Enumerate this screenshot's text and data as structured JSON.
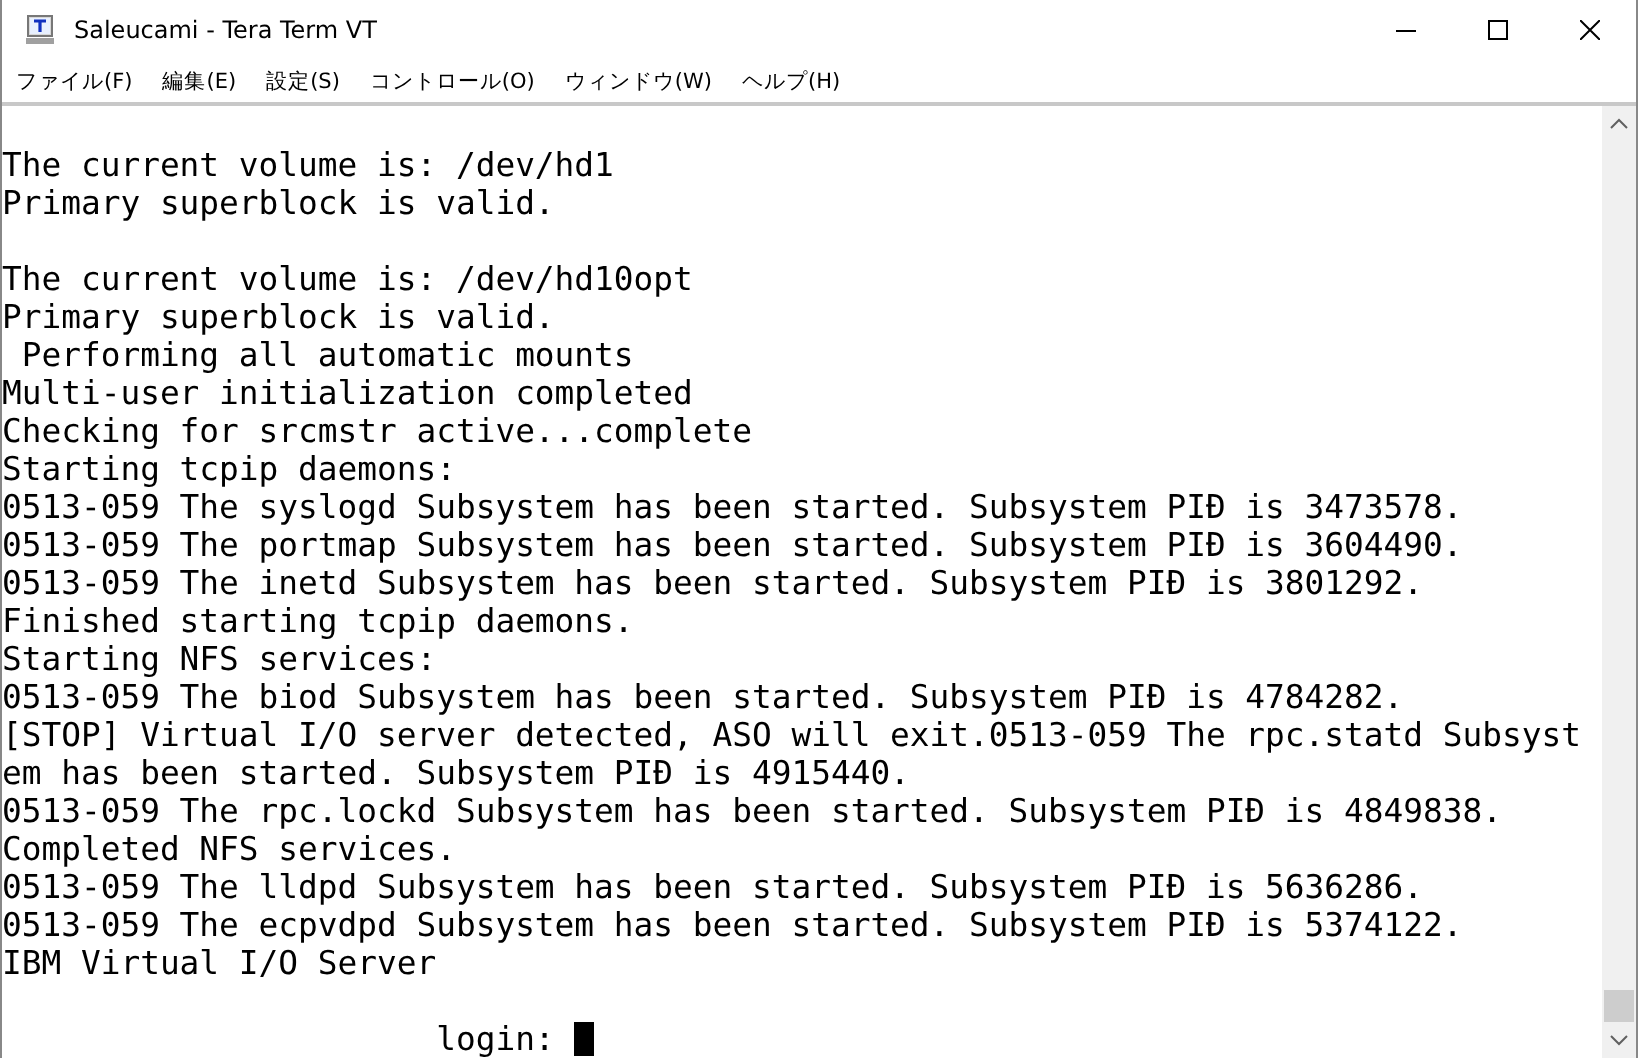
{
  "window": {
    "title": "Saleucami - Tera Term VT"
  },
  "menu": [
    {
      "label": "ファイル(F)"
    },
    {
      "label": "編集(E)"
    },
    {
      "label": "設定(S)"
    },
    {
      "label": "コントロール(O)"
    },
    {
      "label": "ウィンドウ(W)"
    },
    {
      "label": "ヘルプ(H)"
    }
  ],
  "terminal": {
    "lines": [
      {
        "kind": "blank"
      },
      {
        "kind": "text",
        "text": "The current volume is: /dev/hd1"
      },
      {
        "kind": "text",
        "text": "Primary superblock is valid."
      },
      {
        "kind": "blank"
      },
      {
        "kind": "text",
        "text": "The current volume is: /dev/hd10opt"
      },
      {
        "kind": "text",
        "text": "Primary superblock is valid."
      },
      {
        "kind": "text",
        "text": " Performing all automatic mounts"
      },
      {
        "kind": "text",
        "text": "Multi-user initialization completed"
      },
      {
        "kind": "text",
        "text": "Checking for srcmstr active...complete"
      },
      {
        "kind": "text",
        "text": "Starting tcpip daemons:"
      },
      {
        "kind": "text",
        "text": "0513-059 The syslogd Subsystem has been started. Subsystem PIĐ is 3473578."
      },
      {
        "kind": "text",
        "text": "0513-059 The portmap Subsystem has been started. Subsystem PIĐ is 3604490."
      },
      {
        "kind": "text",
        "text": "0513-059 The inetd Subsystem has been started. Subsystem PIĐ is 3801292."
      },
      {
        "kind": "text",
        "text": "Finished starting tcpip daemons."
      },
      {
        "kind": "text",
        "text": "Starting NFS services:"
      },
      {
        "kind": "text",
        "text": "0513-059 The biod Subsystem has been started. Subsystem PIĐ is 4784282."
      },
      {
        "kind": "text",
        "text": "[STOP] Virtual I/O server detected, ASO will exit.0513-059 The rpc.statd Subsyst"
      },
      {
        "kind": "text",
        "text": "em has been started. Subsystem PIĐ is 4915440."
      },
      {
        "kind": "text",
        "text": "0513-059 The rpc.lockd Subsystem has been started. Subsystem PIĐ is 4849838."
      },
      {
        "kind": "text",
        "text": "Completed NFS services."
      },
      {
        "kind": "text",
        "text": "0513-059 The lldpd Subsystem has been started. Subsystem PIĐ is 5636286."
      },
      {
        "kind": "text",
        "text": "0513-059 The ecpvdpd Subsystem has been started. Subsystem PIĐ is 5374122."
      },
      {
        "kind": "text",
        "text": "IBM Virtual I/O Server"
      },
      {
        "kind": "blank"
      },
      {
        "kind": "prompt",
        "text": "                      login:"
      }
    ]
  }
}
